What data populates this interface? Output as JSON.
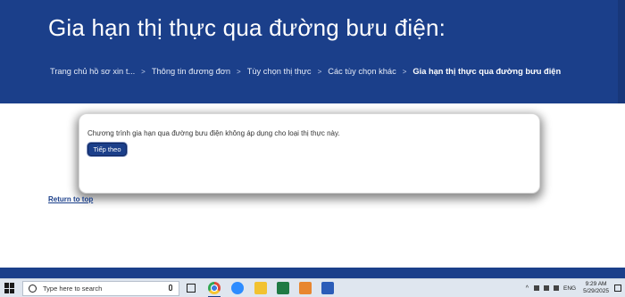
{
  "header": {
    "title": "Gia hạn thị thực qua đường bưu điện:",
    "breadcrumbs": [
      {
        "label": "Trang chủ hồ sơ xin t..."
      },
      {
        "label": "Thông tin đương đơn"
      },
      {
        "label": "Tùy chọn thị thực"
      },
      {
        "label": "Các tùy chọn khác"
      },
      {
        "label": "Gia hạn thị thực qua đường bưu điện"
      }
    ],
    "separator": ">"
  },
  "modal": {
    "message": "Chương trình gia hạn qua đường bưu điện không áp dụng cho loại thị thực này.",
    "next_label": "Tiếp theo"
  },
  "return_link": "Return to top",
  "taskbar": {
    "search_placeholder": "Type here to search",
    "apps": [
      "chrome-icon",
      "zoom-icon",
      "file-explorer-icon",
      "excel-icon",
      "photos-icon",
      "word-icon"
    ],
    "language": "ENG",
    "time": "9:29 AM",
    "date": "5/29/2025"
  },
  "colors": {
    "brand_blue": "#1b3f8a",
    "taskbar": "#dfe6ef"
  }
}
